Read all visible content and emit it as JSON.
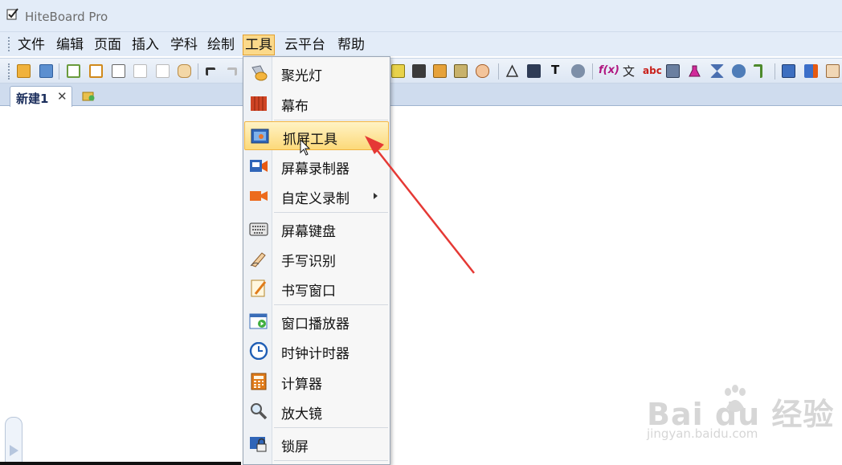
{
  "window": {
    "title": "HiteBoard Pro"
  },
  "menubar": {
    "items": [
      "文件",
      "编辑",
      "页面",
      "插入",
      "学科",
      "绘制",
      "工具",
      "云平台",
      "帮助"
    ],
    "open_item": "工具"
  },
  "toolbar": {
    "glyphs": {
      "text_tool": "T",
      "formula": "f(x)",
      "chinese_text": "文",
      "abc": "abc"
    }
  },
  "tabs": {
    "active_label": "新建1",
    "close_glyph": "✕"
  },
  "tools_menu": {
    "items": [
      {
        "label": "聚光灯",
        "icon": "spotlight-icon"
      },
      {
        "label": "幕布",
        "icon": "curtain-icon"
      },
      {
        "label": "抓屏工具",
        "icon": "screen-capture-icon",
        "highlighted": true
      },
      {
        "label": "屏幕录制器",
        "icon": "screen-recorder-icon"
      },
      {
        "label": "自定义录制",
        "icon": "custom-record-icon",
        "has_submenu": true
      },
      {
        "label": "屏幕键盘",
        "icon": "keyboard-icon"
      },
      {
        "label": "手写识别",
        "icon": "handwriting-recognition-icon"
      },
      {
        "label": "书写窗口",
        "icon": "writing-window-icon"
      },
      {
        "label": "窗口播放器",
        "icon": "window-player-icon"
      },
      {
        "label": "时钟计时器",
        "icon": "clock-timer-icon"
      },
      {
        "label": "计算器",
        "icon": "calculator-icon"
      },
      {
        "label": "放大镜",
        "icon": "magnifier-icon"
      },
      {
        "label": "锁屏",
        "icon": "lock-screen-icon"
      }
    ]
  },
  "watermark": {
    "logo": "Bai du 经验",
    "url": "jingyan.baidu.com"
  },
  "colors": {
    "chrome": "#e3ecf8",
    "menu_open_bg": "#fbd98a",
    "highlight_bg": "#fcd979",
    "annotation_arrow": "#e53935"
  }
}
